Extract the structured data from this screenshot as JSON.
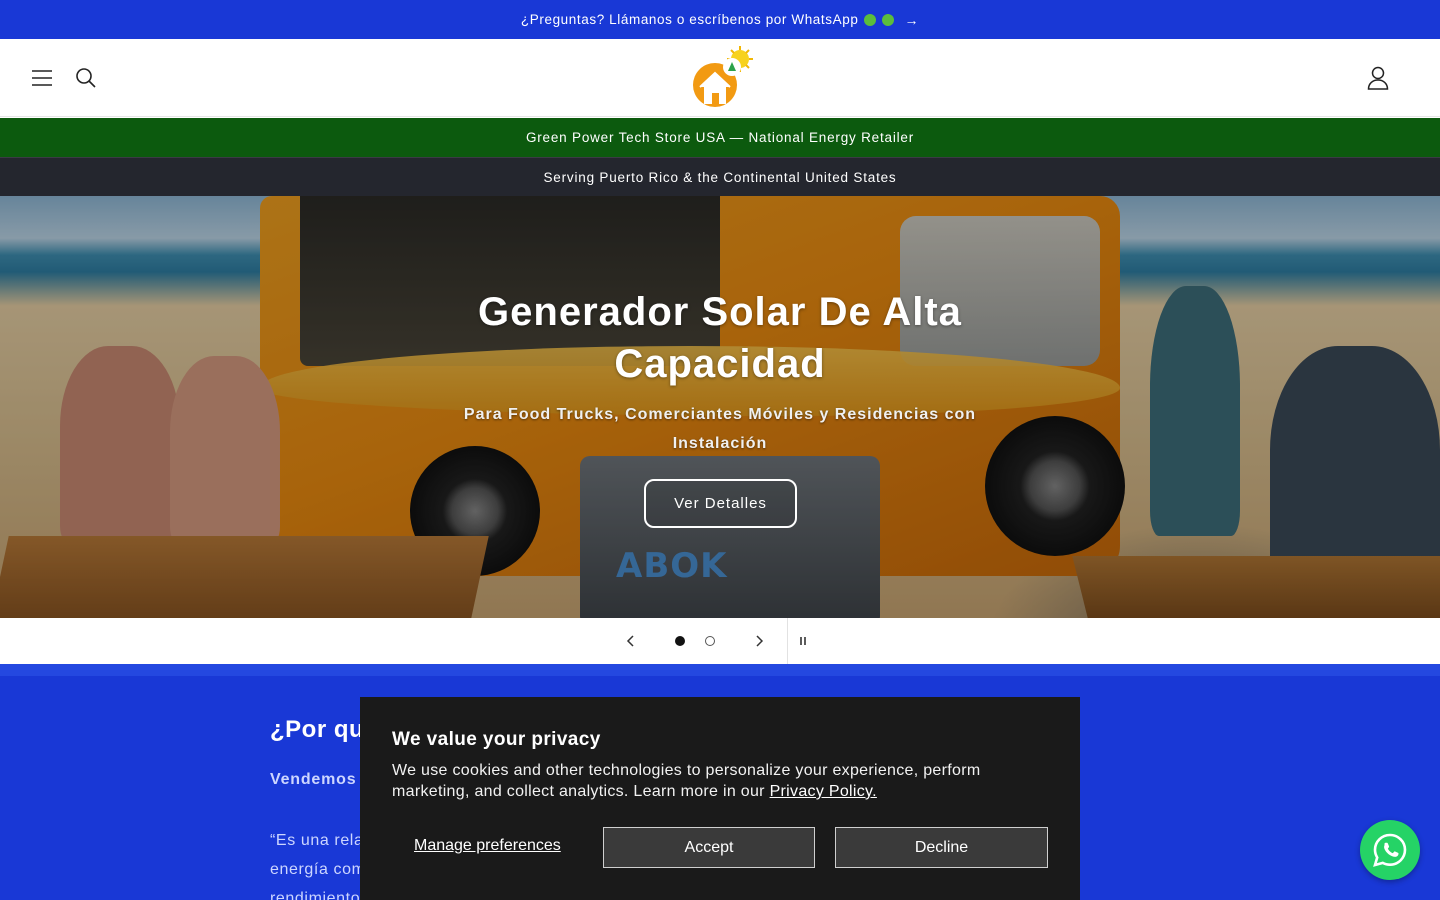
{
  "announcement": {
    "text": "¿Preguntas? Llámanos o escríbenos por WhatsApp",
    "arrow": "→",
    "dot_color": "#5bbd3c"
  },
  "header": {
    "menu_icon": "hamburger-menu-icon",
    "search_icon": "search-icon",
    "account_icon": "user-account-icon",
    "logo_icon": "solar-house-logo"
  },
  "bars": {
    "green": "Green Power Tech Store USA — National Energy Retailer",
    "dark": "Serving Puerto Rico & the Continental United States"
  },
  "hero": {
    "title": "Generador Solar De Alta Capacidad",
    "subtitle": "Para Food Trucks, Comerciantes Móviles y Residencias con Instalación",
    "button": "Ver Detalles",
    "product_brand": "ABOK"
  },
  "slider": {
    "prev_icon": "chevron-left-icon",
    "next_icon": "chevron-right-icon",
    "pause_icon": "pause-icon",
    "slides": [
      {
        "active": true
      },
      {
        "active": false
      }
    ]
  },
  "section": {
    "title": "¿Por qu",
    "bold_line": "Vendemos",
    "quote_lines": [
      "“Es una rela",
      "energía com",
      "rendimiento"
    ]
  },
  "cookie": {
    "title": "We value your privacy",
    "body": "We use cookies and other technologies to personalize your experience, perform marketing, and collect analytics. Learn more in our",
    "link": "Privacy Policy.",
    "manage": "Manage preferences",
    "accept": "Accept",
    "decline": "Decline"
  },
  "whatsapp": {
    "icon": "whatsapp-icon"
  },
  "colors": {
    "brand_blue": "#1938d6",
    "green_bar": "#0c5a0e",
    "dark_bar": "#24262e",
    "cookie_bg": "#1a1a1a",
    "whatsapp_green": "#25d366"
  }
}
